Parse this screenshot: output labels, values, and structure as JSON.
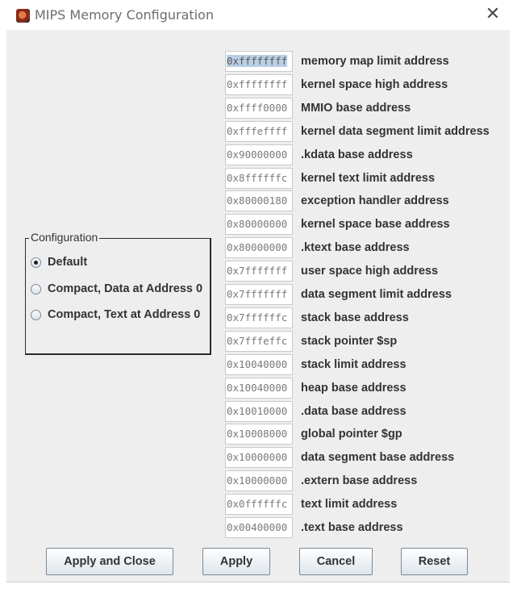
{
  "window": {
    "title": "MIPS Memory Configuration",
    "icon": "mars-planet-icon",
    "close_symbol": "✕"
  },
  "configuration": {
    "legend": "Configuration",
    "options": [
      {
        "label": "Default",
        "selected": true
      },
      {
        "label": "Compact, Data at Address 0",
        "selected": false
      },
      {
        "label": "Compact, Text at Address 0",
        "selected": false
      }
    ]
  },
  "addresses": [
    {
      "value": "0xffffffff",
      "label": "memory map limit address",
      "selected": true
    },
    {
      "value": "0xffffffff",
      "label": "kernel space high address"
    },
    {
      "value": "0xffff0000",
      "label": "MMIO base address"
    },
    {
      "value": "0xfffeffff",
      "label": "kernel data segment limit address"
    },
    {
      "value": "0x90000000",
      "label": ".kdata base address"
    },
    {
      "value": "0x8ffffffc",
      "label": "kernel text limit address"
    },
    {
      "value": "0x80000180",
      "label": "exception handler address"
    },
    {
      "value": "0x80000000",
      "label": "kernel space base address"
    },
    {
      "value": "0x80000000",
      "label": ".ktext base address"
    },
    {
      "value": "0x7fffffff",
      "label": "user space high address"
    },
    {
      "value": "0x7fffffff",
      "label": "data segment limit address"
    },
    {
      "value": "0x7ffffffc",
      "label": "stack base address"
    },
    {
      "value": "0x7fffeffc",
      "label": "stack pointer $sp"
    },
    {
      "value": "0x10040000",
      "label": "stack limit address"
    },
    {
      "value": "0x10040000",
      "label": "heap base address"
    },
    {
      "value": "0x10010000",
      "label": ".data base address"
    },
    {
      "value": "0x10008000",
      "label": "global pointer $gp"
    },
    {
      "value": "0x10000000",
      "label": "data segment base address"
    },
    {
      "value": "0x10000000",
      "label": ".extern base address"
    },
    {
      "value": "0x0ffffffc",
      "label": "text limit address"
    },
    {
      "value": "0x00400000",
      "label": ".text base address"
    }
  ],
  "buttons": {
    "apply_close": "Apply and Close",
    "apply": "Apply",
    "cancel": "Cancel",
    "reset": "Reset"
  }
}
